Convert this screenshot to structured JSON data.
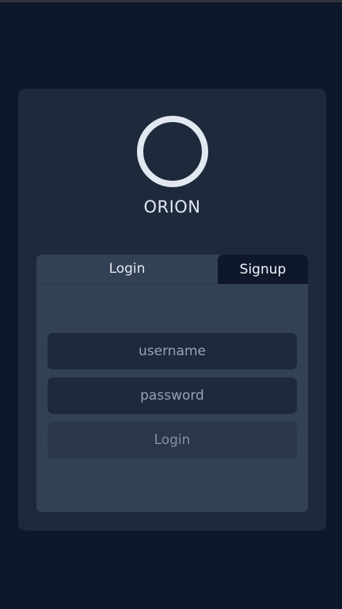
{
  "app": {
    "brand": "ORION"
  },
  "tabs": {
    "login_label": "Login",
    "signup_label": "Signup",
    "active": "Login"
  },
  "form": {
    "username_placeholder": "username",
    "username_value": "",
    "password_placeholder": "password",
    "password_value": "",
    "submit_label": "Login"
  },
  "icons": {
    "logo": "ring-logo-icon"
  },
  "colors": {
    "background": "#0f172a",
    "card": "#1e293b",
    "panel": "#334155",
    "text": "#e2e8f0"
  }
}
